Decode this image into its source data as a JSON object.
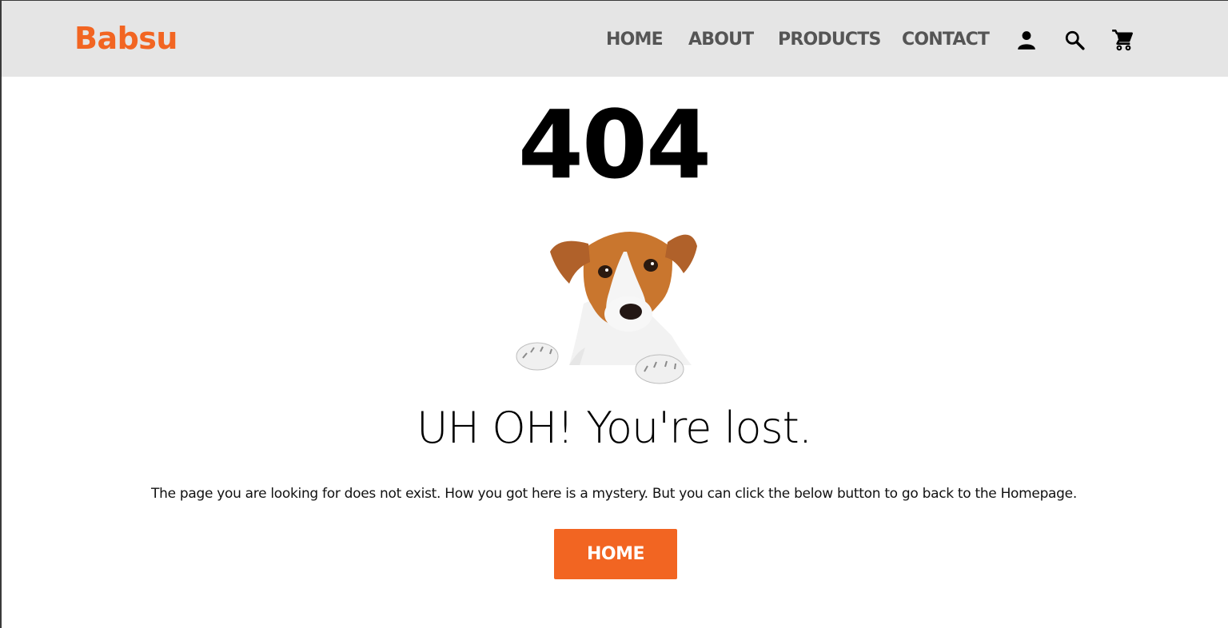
{
  "header": {
    "logo": "Babsu",
    "nav": [
      "HOME",
      "ABOUT",
      "PRODUCTS",
      "CONTACT"
    ],
    "icons": [
      "user-icon",
      "search-icon",
      "cart-icon"
    ]
  },
  "main": {
    "error_code": "404",
    "headline": "UH OH! You're lost.",
    "description": "The page you are looking for does not exist. How you got here is a mystery. But you can click the below button to go back to the Homepage.",
    "button_label": "HOME"
  },
  "colors": {
    "accent": "#f26522",
    "nav_bg": "#e5e5e5",
    "nav_text": "#555555"
  }
}
